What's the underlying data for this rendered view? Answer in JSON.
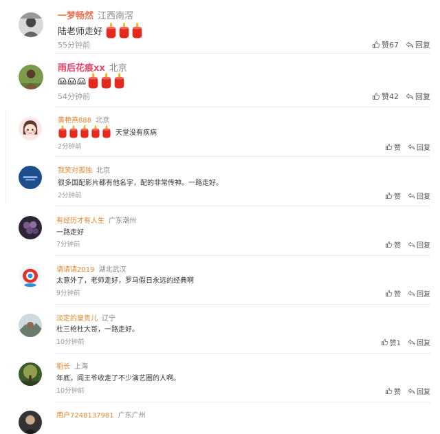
{
  "comments": [
    {
      "name": "一梦畅然",
      "location": "江西南滘",
      "text": "陆老师走好",
      "candles": 3,
      "faces": 0,
      "time": "55分钟前",
      "like_label": "赞67",
      "reply_label": "回复",
      "avatar": "portrait-bw"
    },
    {
      "name": "雨后花痕xx",
      "location": "北京",
      "text": "",
      "candles": 3,
      "faces": 3,
      "time": "54分钟前",
      "like_label": "赞42",
      "reply_label": "回复",
      "avatar": "green-outdoor"
    },
    {
      "name": "黄艳燕888",
      "location": "北京",
      "text": "天堂没有疾病",
      "candles": 5,
      "faces": 0,
      "time": "2分钟前",
      "like_label": "赞",
      "reply_label": "回复",
      "avatar": "cartoon-girl"
    },
    {
      "name": "我笑对孤独",
      "location": "北京",
      "text": "很多国配影片都有他名字，配的非常传神。一路走好。",
      "candles": 0,
      "faces": 0,
      "time": "2分钟前",
      "like_label": "赞",
      "reply_label": "回复",
      "avatar": "blue-circle"
    },
    {
      "name": "有经历才有人生",
      "location": "广东潮州",
      "text": "一路走好",
      "candles": 0,
      "faces": 0,
      "time": "7分钟前",
      "like_label": "赞",
      "reply_label": "回复",
      "avatar": "grapes"
    },
    {
      "name": "请请请2019",
      "location": "湖北武汉",
      "text": "太意外了，老师走好，罗马假日永远的经典啊",
      "candles": 0,
      "faces": 0,
      "time": "9分钟前",
      "like_label": "赞",
      "reply_label": "回复",
      "avatar": "weibo-eye"
    },
    {
      "name": "淡定的皇贵儿",
      "location": "辽宁",
      "text": "杜三枪杜大哥，一路走好。",
      "candles": 0,
      "faces": 0,
      "time": "10分钟前",
      "like_label": "赞1",
      "reply_label": "回复",
      "avatar": "landscape"
    },
    {
      "name": "稻长",
      "location": "上海",
      "text": "年底，阎王爷收走了不少演艺圈的人啊。",
      "candles": 0,
      "faces": 0,
      "time": "10分钟前",
      "like_label": "赞",
      "reply_label": "回复",
      "avatar": "tree"
    },
    {
      "name": "用户7248137981",
      "location": "广东广州",
      "text": "",
      "candles": 0,
      "faces": 0,
      "time": "",
      "like_label": "",
      "reply_label": "",
      "avatar": "dark-portrait"
    }
  ],
  "colors": {
    "name_orange": "#e6852b",
    "name_red": "#eb7350",
    "name_pink": "#e8466b",
    "candle": "#e22b1e",
    "flame": "#f7b500"
  }
}
